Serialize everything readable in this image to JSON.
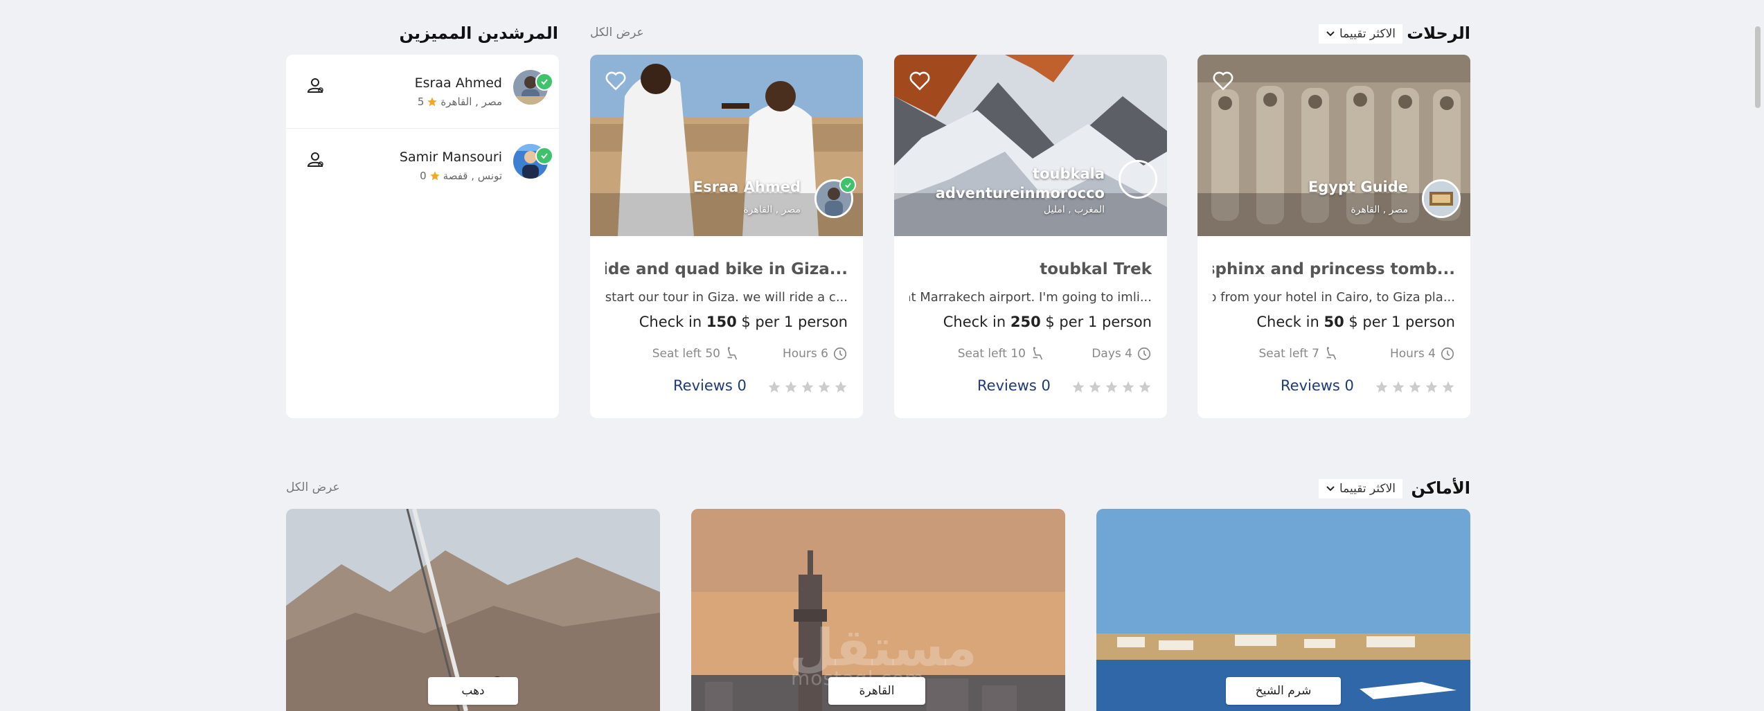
{
  "trips_section": {
    "title": "الرحلات",
    "sort_label": "الاكثر تقييما",
    "see_all": "عرض الكل",
    "cards": [
      {
        "host_name_lines": [
          "Egypt Guide"
        ],
        "host_location": "مصر , القاهرة",
        "title": "...Pyramids, sphinx and princess tomb",
        "description": "...Pick up from your hotel in Cairo, to Giza pla",
        "price_prefix": "Check in",
        "price": "50",
        "price_suffix": "$ per 1 person",
        "seats": "Seat left 7",
        "duration": "Hours 4",
        "reviews": "Reviews 0"
      },
      {
        "host_name_lines": [
          "toubkala",
          "adventureinmorocco"
        ],
        "host_location": "المغرب , امليل",
        "title": "toubkal Trek",
        "description": "...Pick up at Marrakech airport. I'm going to imli",
        "price_prefix": "Check in",
        "price": "250",
        "price_suffix": "$ per 1 person",
        "seats": "Seat left 10",
        "duration": "Days 4",
        "reviews": "Reviews 0"
      },
      {
        "host_name_lines": [
          "Esraa Ahmed"
        ],
        "host_location": "مصر , القاهرة",
        "title": "...Camel Ride and quad bike in Giza",
        "description": "...We will start our tour in Giza. we will ride a c",
        "price_prefix": "Check in",
        "price": "150",
        "price_suffix": "$ per 1 person",
        "seats": "Seat left 50",
        "duration": "Hours 6",
        "reviews": "Reviews 0"
      }
    ]
  },
  "guides_section": {
    "title": "المرشدين المميزين",
    "guides": [
      {
        "name": "Esraa Ahmed",
        "location": "مصر , القاهرة",
        "rating": "5"
      },
      {
        "name": "Samir Mansouri",
        "location": "تونس , قفصة",
        "rating": "0"
      }
    ]
  },
  "places_section": {
    "title": "الأماكن",
    "sort_label": "الاكثر تقييما",
    "see_all": "عرض الكل",
    "places": [
      {
        "name": "شرم الشيخ"
      },
      {
        "name": "القاهرة"
      },
      {
        "name": "دهب"
      }
    ]
  },
  "watermark": {
    "text": "مستقل",
    "url": "mostaql.com"
  },
  "colors": {
    "background": "#f0f1f5",
    "verified": "#3ec26b",
    "star_gold": "#f5a623",
    "reviews_link": "#1e3a7a"
  }
}
